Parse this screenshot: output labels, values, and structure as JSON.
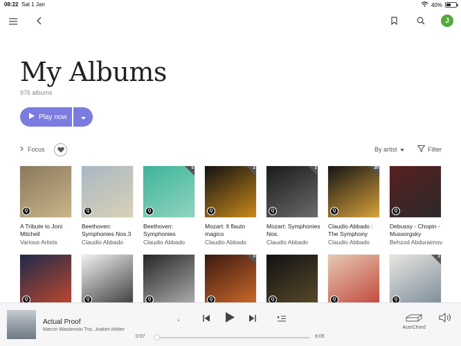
{
  "status": {
    "time": "08:22",
    "date": "Sat 1 Jan",
    "battery": "40%",
    "battery_level": 0.4
  },
  "nav": {
    "avatar_initial": "J"
  },
  "page": {
    "title": "My Albums",
    "count": "976 albums"
  },
  "actions": {
    "play_label": "Play now",
    "focus_label": "Focus",
    "sort_label": "By artist",
    "filter_label": "Filter"
  },
  "albums_row1": [
    {
      "title": "A Tribute to Joni Mitchell",
      "artist": "Various Artists",
      "colors": [
        "#8a7a5c",
        "#c9b48a"
      ],
      "count": ""
    },
    {
      "title": "Beethoven: Symphonies Nos.3",
      "artist": "Claudio Abbado",
      "colors": [
        "#a9b8c4",
        "#d9d1b6"
      ],
      "count": ""
    },
    {
      "title": "Beethoven: Symphonies",
      "artist": "Claudio Abbado",
      "colors": [
        "#3fb49a",
        "#8fd4c0"
      ],
      "count": "5"
    },
    {
      "title": "Mozart: Il flauto magico",
      "artist": "Claudio Abbado",
      "colors": [
        "#121212",
        "#c8891a"
      ],
      "count": "2"
    },
    {
      "title": "Mozart: Symphonies Nos.",
      "artist": "Claudio Abbado",
      "colors": [
        "#1a1a1a",
        "#6b6b6b"
      ],
      "count": "2"
    },
    {
      "title": "Claudio Abbado : The Symphony",
      "artist": "Claudio Abbado",
      "colors": [
        "#151515",
        "#d8a23a"
      ],
      "count": "20"
    },
    {
      "title": "Debussy - Chopin - Mussorgsky",
      "artist": "Behzod Abduraimov",
      "colors": [
        "#5a1f1f",
        "#2a2a2a"
      ],
      "count": ""
    }
  ],
  "albums_row2": [
    {
      "colors": [
        "#1e2b4a",
        "#c0482e"
      ],
      "count": ""
    },
    {
      "colors": [
        "#f2f2f2",
        "#3a3a3a"
      ],
      "count": ""
    },
    {
      "colors": [
        "#262626",
        "#b0b0b0"
      ],
      "count": ""
    },
    {
      "colors": [
        "#3b1a12",
        "#d06a2a"
      ],
      "count": "3"
    },
    {
      "colors": [
        "#121212",
        "#5a4a2a"
      ],
      "count": ""
    },
    {
      "colors": [
        "#e6c9b3",
        "#c2473b"
      ],
      "count": ""
    },
    {
      "colors": [
        "#e8e6e0",
        "#7b8b9a"
      ],
      "count": "2"
    }
  ],
  "player": {
    "title": "Actual Proof",
    "artist": "Marcin Wasilewski Trio, Joakim Milder",
    "elapsed": "0:07",
    "duration": "6:05",
    "progress": 0.019,
    "device": "AcerChord"
  }
}
